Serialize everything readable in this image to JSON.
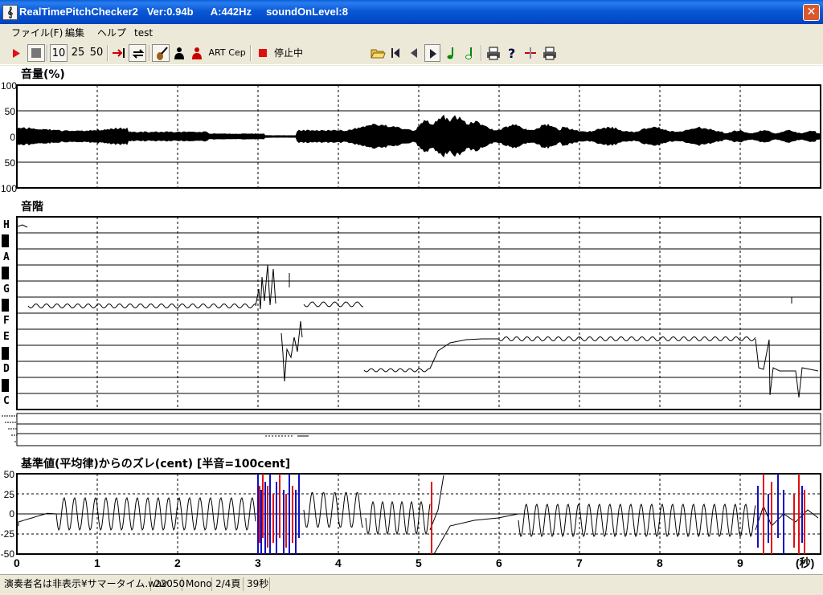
{
  "window": {
    "title": "RealTimePitchChecker2   Ver:0.94b      A:442Hz     soundOnLevel:8",
    "app_icon": "treble-clef-icon",
    "close_symbol": "✕"
  },
  "menu": [
    "ファイル(F)",
    "編集",
    "ヘルプ",
    "test"
  ],
  "toolbar": {
    "play_icon": "play-icon",
    "stop_icon": "stop-icon",
    "speed_10": "10",
    "speed_25": "25",
    "speed_50": "50",
    "art_label": "ART",
    "cep_label": "Cep",
    "stopped_label": "停止中",
    "status_display": "＊＊＊"
  },
  "volume_panel": {
    "title": "音量(%)",
    "y_ticks": [
      "100",
      "50",
      "0",
      "50",
      "100"
    ]
  },
  "scale_panel": {
    "title": "音階",
    "notes": [
      "H",
      "A",
      "G",
      "F",
      "E",
      "D",
      "C"
    ]
  },
  "deviation_panel": {
    "title": "基準値(平均律)からのズレ(cent) [半音=100cent]",
    "y_ticks": [
      "50",
      "25",
      "0",
      "-25",
      "-50"
    ]
  },
  "x_axis": {
    "ticks": [
      "0",
      "1",
      "2",
      "3",
      "4",
      "5",
      "6",
      "7",
      "8",
      "9"
    ],
    "unit": "(秒)"
  },
  "statusbar": {
    "file": "演奏者名は非表示¥サマータイム.wav",
    "rate": "22050",
    "channels": "Mono",
    "page": "2/4頁",
    "duration": "39秒"
  },
  "colors": {
    "title_bar": "#0a58d6",
    "plot_line": "#000000",
    "deviation_red": "#e01010",
    "deviation_blue": "#1010c0"
  }
}
